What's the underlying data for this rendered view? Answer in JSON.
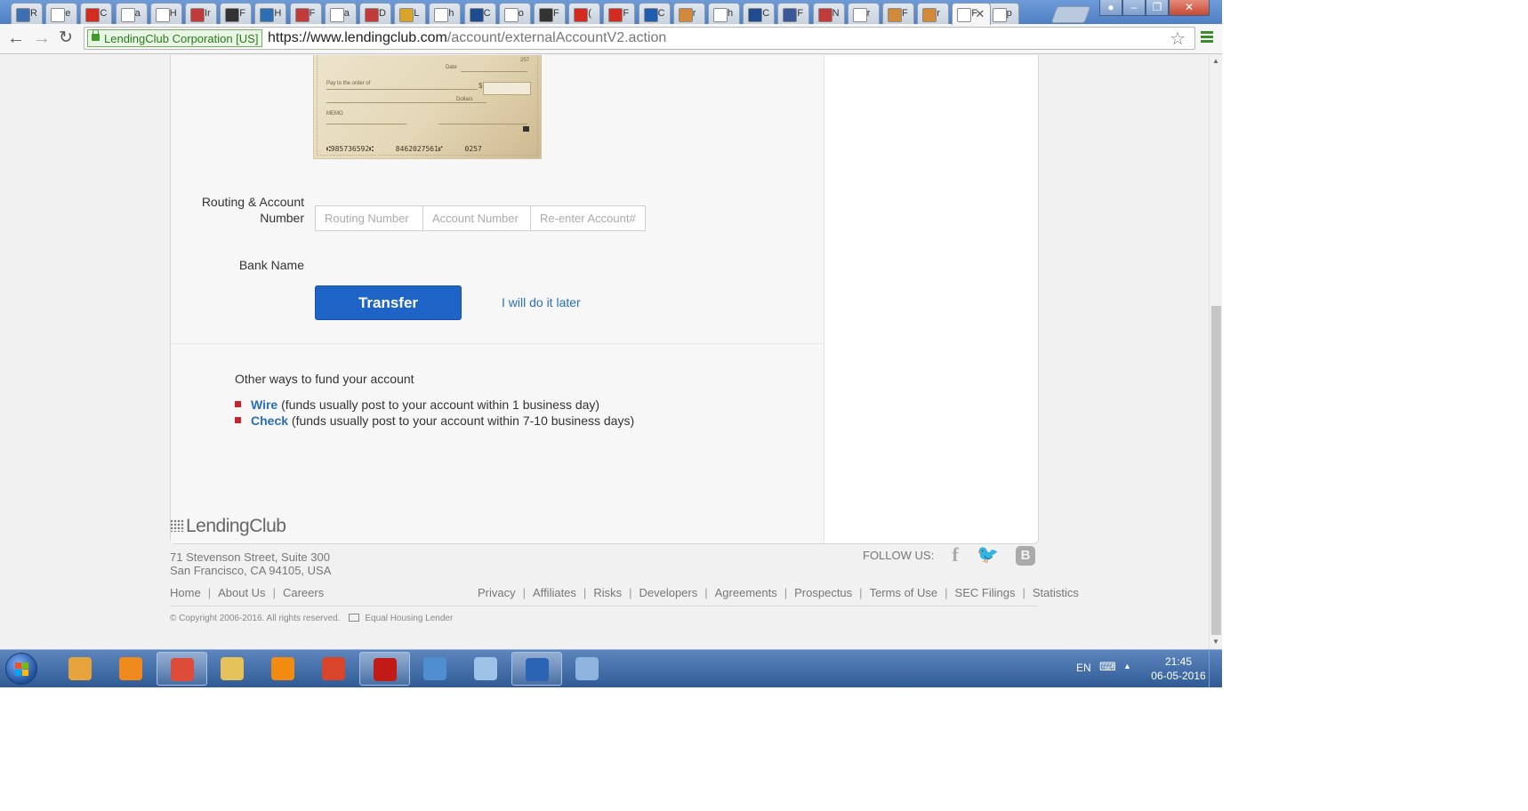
{
  "tabs": [
    {
      "label": "R",
      "color": "#3f6fb3"
    },
    {
      "label": "e",
      "color": "#ffffff"
    },
    {
      "label": "C",
      "color": "#d42b20"
    },
    {
      "label": "a",
      "color": "#ffffff"
    },
    {
      "label": "H",
      "color": "#ffffff"
    },
    {
      "label": "Ir",
      "color": "#c23b3b"
    },
    {
      "label": "F",
      "color": "#333333"
    },
    {
      "label": "H",
      "color": "#2d6fb3"
    },
    {
      "label": "F",
      "color": "#c23b3b"
    },
    {
      "label": "a",
      "color": "#ffffff"
    },
    {
      "label": "D",
      "color": "#c23b3b"
    },
    {
      "label": "L",
      "color": "#d6a52a"
    },
    {
      "label": "h",
      "color": "#ffffff"
    },
    {
      "label": "C",
      "color": "#1f4b8f"
    },
    {
      "label": "o",
      "color": "#ffffff"
    },
    {
      "label": "F",
      "color": "#333333"
    },
    {
      "label": "(",
      "color": "#d42b20"
    },
    {
      "label": "F",
      "color": "#d42b20"
    },
    {
      "label": "C",
      "color": "#1f5db0"
    },
    {
      "label": "r",
      "color": "#d08a3a"
    },
    {
      "label": "h",
      "color": "#ffffff"
    },
    {
      "label": "C",
      "color": "#1f4b8f"
    },
    {
      "label": "F",
      "color": "#3b5998"
    },
    {
      "label": "N",
      "color": "#c23b3b"
    },
    {
      "label": "r",
      "color": "#ffffff"
    },
    {
      "label": "F",
      "color": "#d08a3a"
    },
    {
      "label": "r",
      "color": "#d08a3a"
    },
    {
      "label": "F",
      "color": "#ffffff",
      "active": true
    },
    {
      "label": "p",
      "color": "#ffffff"
    }
  ],
  "address_bar": {
    "ev_badge": "LendingClub Corporation [US]",
    "url_domain": "https://www.lendingclub.com",
    "url_path": "/account/externalAccountV2.action"
  },
  "check": {
    "date_label": "Date",
    "pay_label": "Pay to the order of",
    "dollars_label": "Dollars",
    "memo_label": "MEMO",
    "number": "257",
    "micr": "⑆985736592⑆ 8462027561⑈ 0257"
  },
  "form": {
    "routing_label": "Routing & Account Number",
    "routing_placeholder": "Routing Number",
    "account_placeholder": "Account Number",
    "reenter_placeholder": "Re-enter Account#",
    "bank_name_label": "Bank Name",
    "transfer_button": "Transfer",
    "later_link": "I will do it later"
  },
  "other_ways": {
    "title": "Other ways to fund your account",
    "items": [
      {
        "link": "Wire",
        "text": " (funds usually post to your account within 1 business day)"
      },
      {
        "link": "Check",
        "text": " (funds usually post to your account within 7-10 business days)"
      }
    ]
  },
  "footer": {
    "logo": "LendingClub",
    "address1": "71 Stevenson Street, Suite 300",
    "address2": "San Francisco, CA 94105, USA",
    "follow_us": "FOLLOW US:",
    "left_links": [
      "Home",
      "About Us",
      "Careers"
    ],
    "right_links": [
      "Privacy",
      "Affiliates",
      "Risks",
      "Developers",
      "Agreements",
      "Prospectus",
      "Terms of Use",
      "SEC Filings",
      "Statistics"
    ],
    "copyright": "© Copyright 2006-2016. All rights reserved.",
    "equal_housing": "Equal Housing Lender"
  },
  "taskbar": {
    "apps": [
      {
        "name": "vlc-media-player",
        "color": "#e8a33d"
      },
      {
        "name": "media-player",
        "color": "#f08a1c"
      },
      {
        "name": "chrome",
        "color": "#dd4b39",
        "open": true
      },
      {
        "name": "file-explorer",
        "color": "#e6c35a"
      },
      {
        "name": "vlc",
        "color": "#f28c10"
      },
      {
        "name": "presentation",
        "color": "#d9452b"
      },
      {
        "name": "adobe-reader",
        "color": "#c11b17",
        "open": true
      },
      {
        "name": "photo-viewer",
        "color": "#4f8fd0"
      },
      {
        "name": "notepad",
        "color": "#9fc3e6"
      },
      {
        "name": "r-console",
        "color": "#2b63b5",
        "open": true
      },
      {
        "name": "paint",
        "color": "#8fb4dd"
      }
    ],
    "language": "EN",
    "time": "21:45",
    "date": "06-05-2016"
  }
}
